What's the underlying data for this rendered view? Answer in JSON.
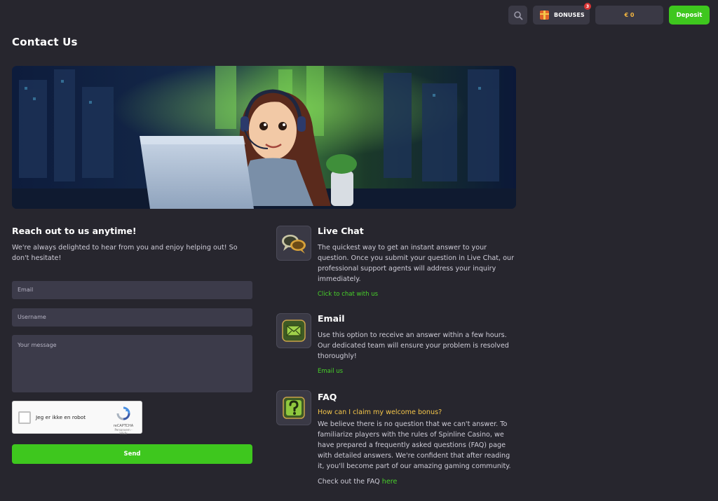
{
  "header": {
    "bonuses_label": "BONUSES",
    "bonuses_count": "3",
    "balance": "€ 0",
    "deposit_label": "Deposit"
  },
  "page": {
    "title": "Contact Us"
  },
  "form": {
    "heading": "Reach out to us anytime!",
    "subtext": "We're always delighted to hear from you and enjoy helping out! So don't hesitate!",
    "email_placeholder": "Email",
    "username_placeholder": "Username",
    "message_placeholder": "Your message",
    "captcha_label": "Jeg er ikke en robot",
    "captcha_brand": "reCAPTCHA",
    "captcha_terms": "Personvern - Vilkår",
    "send_label": "Send"
  },
  "live_chat": {
    "title": "Live Chat",
    "body": "The quickest way to get an instant answer to your question. Once you submit your question in Live Chat, our professional support agents will address your inquiry immediately.",
    "link": "Click to chat with us"
  },
  "email_section": {
    "title": "Email",
    "body": "Use this option to receive an answer within a few hours. Our dedicated team will ensure your problem is resolved thoroughly!",
    "link": "Email us"
  },
  "faq": {
    "title": "FAQ",
    "question": "How can I claim my welcome bonus?",
    "body": "We believe there is no question that we can't answer. To familiarize players with the rules of Spinline Casino, we have prepared a frequently asked questions (FAQ) page with detailed answers. We're confident that after reading it, you'll become part of our amazing gaming community.",
    "footer_text": "Check out the FAQ",
    "footer_link": "here"
  },
  "colors": {
    "background": "#27262e",
    "accent_green": "#3ec71e",
    "link_green": "#48d22a",
    "faq_question": "#f5c64a",
    "panel": "#3a3945"
  },
  "icons": [
    "search-icon",
    "gift-icon",
    "chat-bubbles-icon",
    "envelope-icon",
    "question-mark-icon",
    "recaptcha-icon"
  ]
}
